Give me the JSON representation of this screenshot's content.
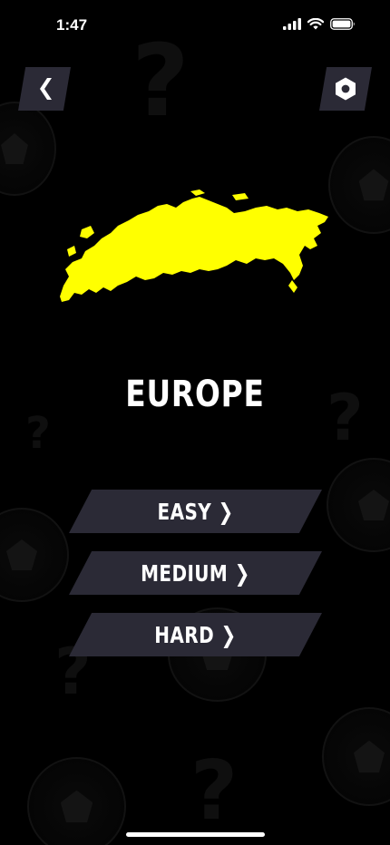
{
  "status_bar": {
    "time": "1:47"
  },
  "header": {
    "back_icon": "chevron-left-icon",
    "settings_icon": "hexagon-gear-icon"
  },
  "region": {
    "name": "EUROPE",
    "map_color": "#FFFF00"
  },
  "difficulty": {
    "easy_label": "EASY ❯",
    "medium_label": "MEDIUM ❯",
    "hard_label": "HARD ❯"
  },
  "colors": {
    "background": "#000000",
    "button_bg": "#2B2A36",
    "text": "#FFFFFF",
    "accent": "#FFFF00"
  }
}
